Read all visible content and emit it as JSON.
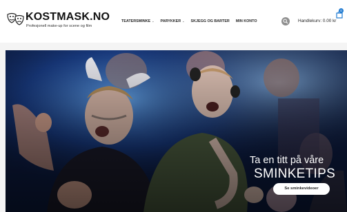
{
  "brand": {
    "name": "KOSTMASK.NO",
    "tagline": "Profesjonell make-up for scene og film"
  },
  "nav": {
    "items": [
      {
        "label": "TEATERSMINKE",
        "has_dropdown": true
      },
      {
        "label": "PARYKKER",
        "has_dropdown": true
      },
      {
        "label": "SKJEGG OG BARTER",
        "has_dropdown": false
      },
      {
        "label": "MIN KONTO",
        "has_dropdown": false
      }
    ]
  },
  "cart": {
    "label": "Handlekurv: 0.00 kr",
    "count": "0"
  },
  "hero": {
    "heading": "Ta en titt på våre",
    "subheading": "SMINKETIPS",
    "button_label": "Se sminkevideoer"
  },
  "colors": {
    "accent": "#1f7ad1",
    "search_button": "#8f8f8f",
    "hero_background": "#0d1a3a"
  }
}
